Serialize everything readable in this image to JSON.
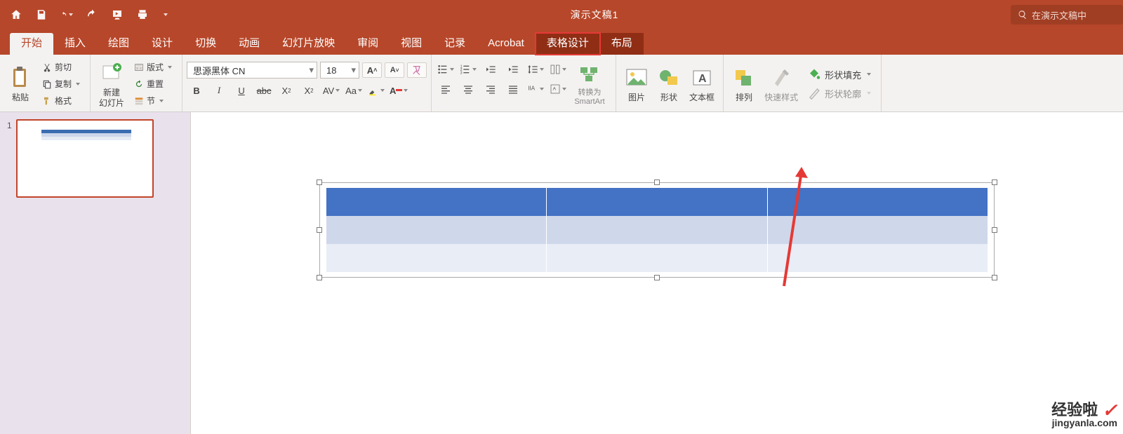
{
  "title": "演示文稿1",
  "search_placeholder": "在演示文稿中",
  "tabs": {
    "home": "开始",
    "insert": "插入",
    "draw": "绘图",
    "design": "设计",
    "transitions": "切换",
    "animations": "动画",
    "slideshow": "幻灯片放映",
    "review": "审阅",
    "view": "视图",
    "record": "记录",
    "acrobat": "Acrobat",
    "tabledesign": "表格设计",
    "layout": "布局"
  },
  "ribbon": {
    "paste": "粘贴",
    "cut": "剪切",
    "copy": "复制",
    "format": "格式",
    "new_slide": "新建\n幻灯片",
    "layout_btn": "版式",
    "reset": "重置",
    "section": "节",
    "font_name": "思源黑体 CN",
    "font_size": "18",
    "smartart_top": "转换为",
    "smartart_bottom": "SmartArt",
    "picture": "图片",
    "shapes": "形状",
    "textbox": "文本框",
    "arrange": "排列",
    "quickstyle": "快速样式",
    "shapefill": "形状填充",
    "shapeoutline": "形状轮廓"
  },
  "thumb": {
    "num": "1"
  },
  "watermark": {
    "line1": "经验啦",
    "line2": "jingyanla.com"
  }
}
